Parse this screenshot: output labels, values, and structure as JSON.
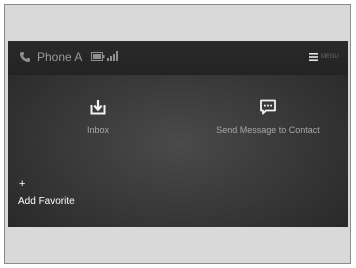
{
  "status_bar": {
    "phone_name": "Phone A",
    "phone_icon": "phone-icon",
    "battery_icon": "battery-icon",
    "signal_icon": "signal-icon",
    "menu_icon": "menu-icon",
    "menu_label": "MENU"
  },
  "tiles": [
    {
      "label": "Inbox",
      "icon": "inbox-download-icon"
    },
    {
      "label": "Send Message to Contact",
      "icon": "message-bubble-icon"
    }
  ],
  "add_favorite": {
    "icon": "plus-icon",
    "symbol": "+",
    "label": "Add Favorite"
  },
  "colors": {
    "screen_bg": "#363636",
    "status_bar_bg": "#232323",
    "text_muted": "#a8a8a8",
    "text_bright": "#ffffff",
    "frame_bg": "#d9d9d9"
  }
}
